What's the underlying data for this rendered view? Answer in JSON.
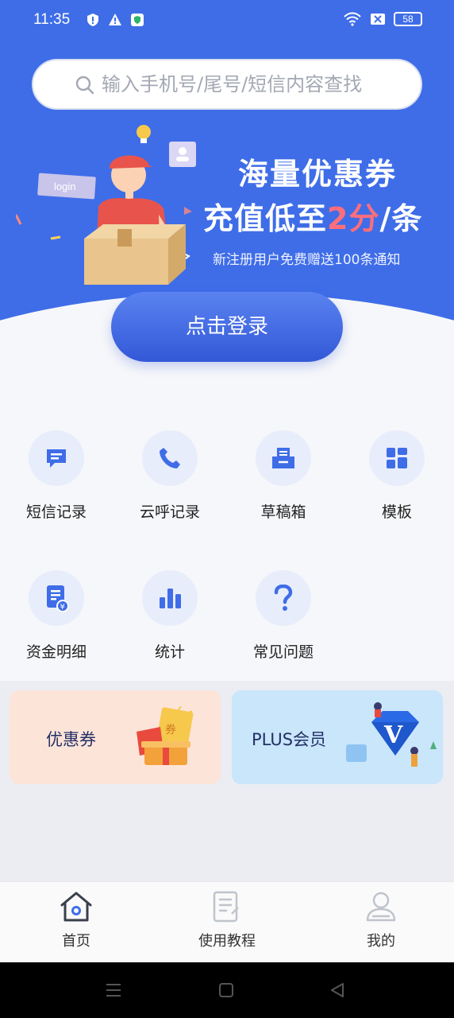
{
  "status": {
    "time": "11:35",
    "battery": "58"
  },
  "search": {
    "placeholder": "输入手机号/尾号/短信内容查找"
  },
  "banner": {
    "tag": "login",
    "title": "海量优惠券",
    "subtitle_prefix": "充值低至",
    "subtitle_highlight": "2分",
    "subtitle_suffix": "/条",
    "note": "新注册用户免费赠送100条通知"
  },
  "login": {
    "label": "点击登录"
  },
  "grid": [
    {
      "label": "短信记录",
      "icon": "sms-icon"
    },
    {
      "label": "云呼记录",
      "icon": "phone-icon"
    },
    {
      "label": "草稿箱",
      "icon": "drafts-icon"
    },
    {
      "label": "模板",
      "icon": "template-icon"
    },
    {
      "label": "资金明细",
      "icon": "funds-icon"
    },
    {
      "label": "统计",
      "icon": "stats-icon"
    },
    {
      "label": "常见问题",
      "icon": "faq-icon"
    }
  ],
  "promos": {
    "coupon": {
      "label": "优惠券",
      "badge": "券"
    },
    "plus": {
      "label": "PLUS会员",
      "badge": "V"
    }
  },
  "tabs": [
    {
      "label": "首页",
      "icon": "home-icon",
      "active": true
    },
    {
      "label": "使用教程",
      "icon": "tutorial-icon"
    },
    {
      "label": "我的",
      "icon": "profile-icon"
    }
  ],
  "colors": {
    "brand": "#3f6de8",
    "accent_highlight": "#ff6e7a",
    "icon_blue": "#3f6de8"
  }
}
